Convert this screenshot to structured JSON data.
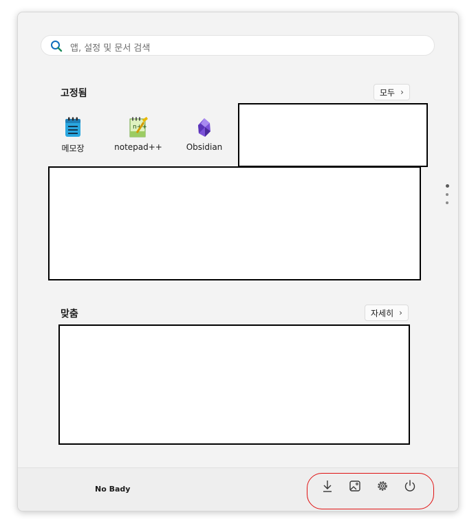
{
  "search": {
    "placeholder": "앱, 설정 및 문서 검색"
  },
  "pinned": {
    "title": "고정됨",
    "all_button": "모두",
    "apps": [
      {
        "label": "메모장",
        "icon": "notepad-icon"
      },
      {
        "label": "notepad++",
        "icon": "notepadpp-icon"
      },
      {
        "label": "Obsidian",
        "icon": "obsidian-icon"
      }
    ]
  },
  "recommended": {
    "title": "맞춤",
    "more_button": "자세히"
  },
  "footer": {
    "user_name": "No Bady",
    "buttons": [
      {
        "name": "downloads-button",
        "icon": "download-icon"
      },
      {
        "name": "pictures-button",
        "icon": "image-icon"
      },
      {
        "name": "settings-button",
        "icon": "gear-icon"
      },
      {
        "name": "power-button",
        "icon": "power-icon"
      }
    ]
  },
  "colors": {
    "accent_search": "#0f6cbd",
    "highlight_outline": "#e01010",
    "redaction_border": "#000000"
  }
}
